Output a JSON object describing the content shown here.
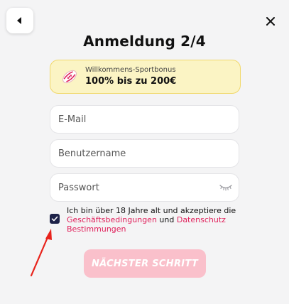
{
  "header": {
    "title": "Anmeldung 2/4",
    "back_icon": "caret-left-icon",
    "close_icon": "close-icon"
  },
  "bonus": {
    "label": "Willkommens-Sportbonus",
    "value": "100% bis zu 200€",
    "icon": "rugby-ball-icon"
  },
  "form": {
    "email_placeholder": "E-Mail",
    "username_placeholder": "Benutzername",
    "password_placeholder": "Passwort",
    "password_toggle_icon": "eye-closed-icon"
  },
  "terms": {
    "checked": true,
    "text_before": "Ich bin über 18 Jahre alt und akzeptiere die ",
    "terms_link": "Geschäftsbedingungen",
    "text_middle": " und ",
    "privacy_link": "Datenschutz Bestimmungen"
  },
  "next_button": {
    "label": "NÄCHSTER SCHRITT"
  },
  "colors": {
    "background": "#f4f4f5",
    "bonus_bg": "#fbf4c4",
    "bonus_border": "#f1d86a",
    "link": "#e0205b",
    "checkbox": "#1d2248",
    "button_disabled": "#fac0cb",
    "annotation_arrow": "#e8231c"
  }
}
